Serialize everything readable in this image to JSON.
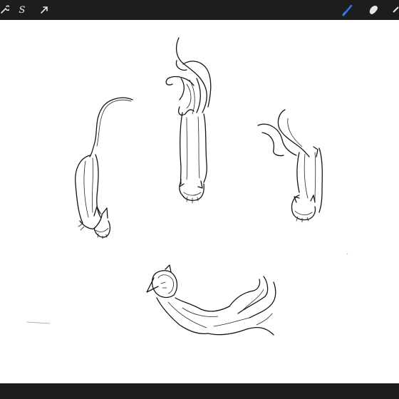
{
  "toolbar": {
    "tools": [
      {
        "icon": "wrench-icon",
        "active": false
      },
      {
        "icon": "selection-s-icon",
        "label": "S",
        "active": false
      },
      {
        "icon": "transform-arrow-icon",
        "active": false
      }
    ],
    "right_tools": [
      {
        "icon": "brush-icon",
        "active": true,
        "color": "#2f7cf6"
      },
      {
        "icon": "smudge-icon",
        "active": false
      },
      {
        "icon": "eraser-icon",
        "active": false
      }
    ]
  },
  "colors": {
    "toolbar_bg": "#1d1d1d",
    "canvas_bg": "#ffffff",
    "active_tool": "#2f7cf6",
    "ink": "#151515"
  },
  "canvas": {
    "sketches": [
      {
        "name": "cat-sketch-left",
        "description_hidden": true
      },
      {
        "name": "cat-sketch-top"
      },
      {
        "name": "cat-sketch-right"
      },
      {
        "name": "cat-sketch-bottom"
      }
    ]
  }
}
